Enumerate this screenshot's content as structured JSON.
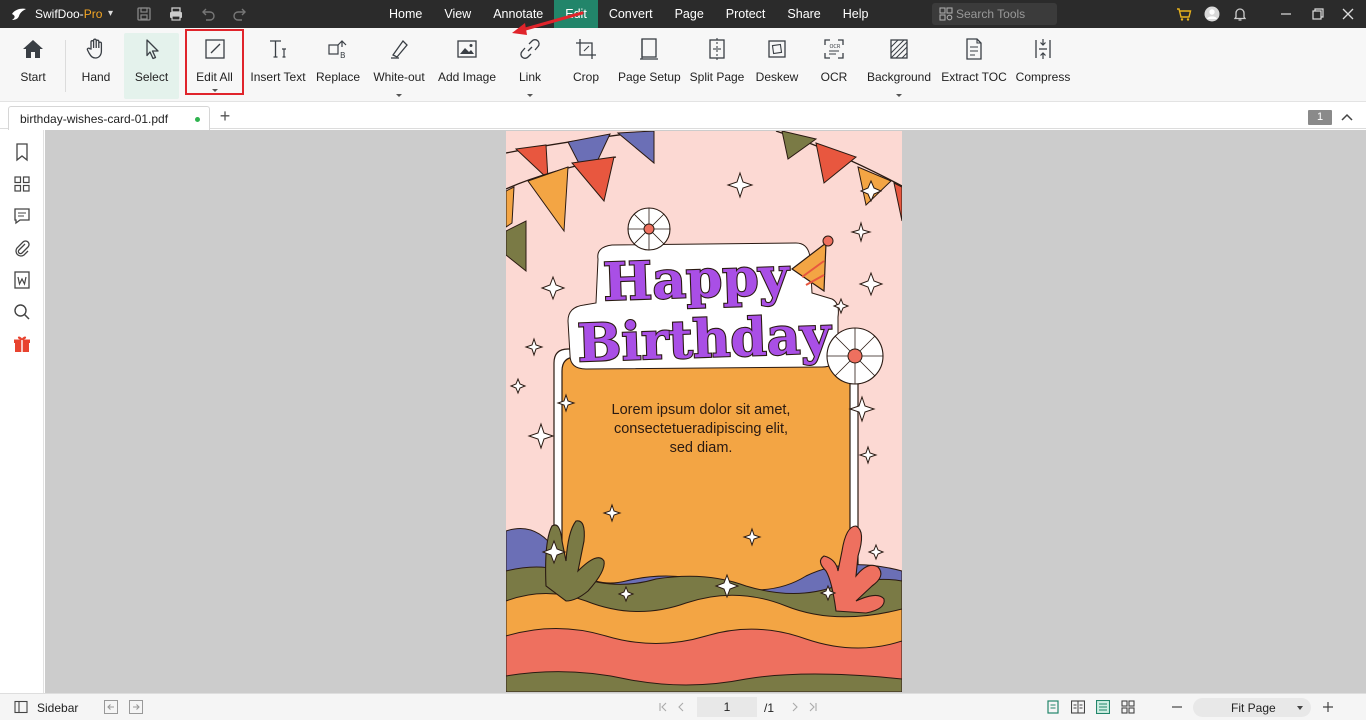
{
  "app": {
    "name_prefix": "SwifDoo-",
    "name_suffix": "Pro",
    "menu_caret": "▾"
  },
  "menus": [
    "Home",
    "View",
    "Annotate",
    "Edit",
    "Convert",
    "Page",
    "Protect",
    "Share",
    "Help"
  ],
  "active_menu": "Edit",
  "search": {
    "placeholder": "Search Tools"
  },
  "ribbon": {
    "start": "Start",
    "hand": "Hand",
    "select": "Select",
    "edit_all": "Edit All",
    "insert_text": "Insert Text",
    "replace": "Replace",
    "white_out": "White-out",
    "add_image": "Add Image",
    "link": "Link",
    "crop": "Crop",
    "page_setup": "Page Setup",
    "split_page": "Split Page",
    "deskew": "Deskew",
    "ocr": "OCR",
    "background": "Background",
    "extract_toc": "Extract TOC",
    "compress": "Compress"
  },
  "tab": {
    "filename": "birthday-wishes-card-01.pdf",
    "new_tab": "+"
  },
  "page_badge": "1",
  "card": {
    "line1": "Happy",
    "line2": "Birthday",
    "body": [
      "Lorem ipsum dolor sit amet,",
      "consectetueradipiscing elit,",
      "sed diam."
    ]
  },
  "status": {
    "sidebar_label": "Sidebar",
    "page_current": "1",
    "page_total": "/1",
    "zoom": "Fit Page"
  },
  "colors": {
    "active_menu": "#22856a",
    "highlight": "#e0242b",
    "card_bg": "#fcd9d3",
    "title_purple": "#a94fe6",
    "card_orange": "#f3a544"
  }
}
